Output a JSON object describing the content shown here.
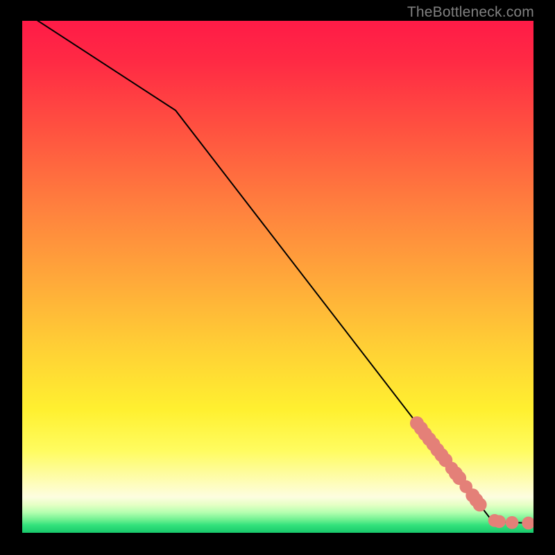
{
  "watermark": "TheBottleneck.com",
  "colors": {
    "line": "#000000",
    "marker": "#e48078",
    "frame_bg_top": "#ff1b47",
    "frame_bg_bottom": "#18c96b"
  },
  "chart_data": {
    "type": "line",
    "title": "",
    "xlabel": "",
    "ylabel": "",
    "xlim": [
      0,
      100
    ],
    "ylim": [
      0,
      100
    ],
    "grid": false,
    "line_points": [
      {
        "x": 0,
        "y": 102
      },
      {
        "x": 30,
        "y": 82.5
      },
      {
        "x": 92,
        "y": 2.2
      },
      {
        "x": 99,
        "y": 1.9
      }
    ],
    "markers": [
      {
        "x": 77.2,
        "y": 21.4,
        "r": 1.0
      },
      {
        "x": 78.0,
        "y": 20.4,
        "r": 1.0
      },
      {
        "x": 78.8,
        "y": 19.3,
        "r": 1.0
      },
      {
        "x": 79.6,
        "y": 18.3,
        "r": 1.0
      },
      {
        "x": 80.4,
        "y": 17.3,
        "r": 1.0
      },
      {
        "x": 81.2,
        "y": 16.2,
        "r": 1.0
      },
      {
        "x": 82.0,
        "y": 15.2,
        "r": 1.0
      },
      {
        "x": 82.8,
        "y": 14.2,
        "r": 1.0
      },
      {
        "x": 84.0,
        "y": 12.6,
        "r": 0.9
      },
      {
        "x": 84.8,
        "y": 11.6,
        "r": 1.0
      },
      {
        "x": 85.5,
        "y": 10.7,
        "r": 1.0
      },
      {
        "x": 86.8,
        "y": 9.0,
        "r": 0.9
      },
      {
        "x": 88.1,
        "y": 7.3,
        "r": 1.0
      },
      {
        "x": 88.8,
        "y": 6.4,
        "r": 1.0
      },
      {
        "x": 89.5,
        "y": 5.5,
        "r": 1.0
      },
      {
        "x": 92.4,
        "y": 2.4,
        "r": 0.9
      },
      {
        "x": 93.3,
        "y": 2.2,
        "r": 0.9
      },
      {
        "x": 95.8,
        "y": 2.0,
        "r": 0.9
      },
      {
        "x": 99.0,
        "y": 1.9,
        "r": 0.9
      }
    ]
  }
}
